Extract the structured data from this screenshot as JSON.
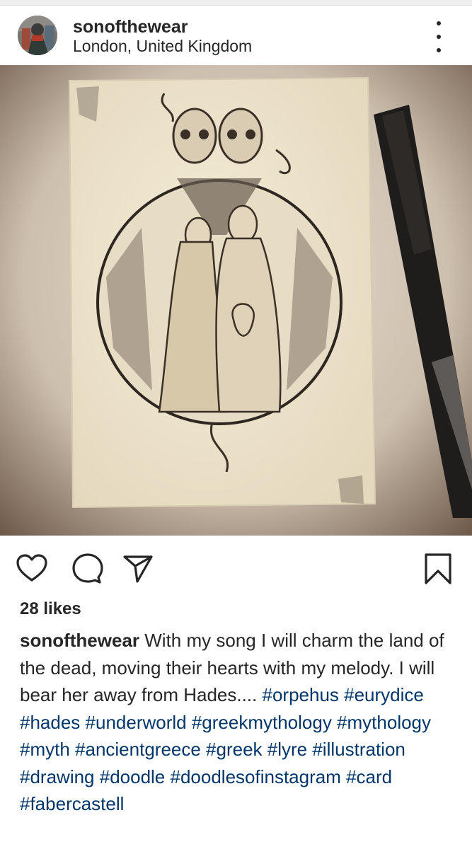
{
  "post": {
    "username": "sonofthewear",
    "location": "London, United Kingdom",
    "likes": "28 likes",
    "caption_text": "With my song I will charm the land of the dead, moving their hearts with my melody. I will bear her away from Hades....",
    "hashtags": "#orpehus #eurydice #hades #underworld #greekmythology #mythology #myth #ancientgreece #greek #lyre #illustration #drawing #doodle #doodlesofinstagram #card #fabercastell"
  },
  "icons": {
    "more": "more-options-icon",
    "like": "heart-icon",
    "comment": "comment-icon",
    "share": "paper-plane-icon",
    "save": "bookmark-icon"
  },
  "colors": {
    "text": "#262626",
    "hashtag": "#003569",
    "divider": "#efefef"
  }
}
